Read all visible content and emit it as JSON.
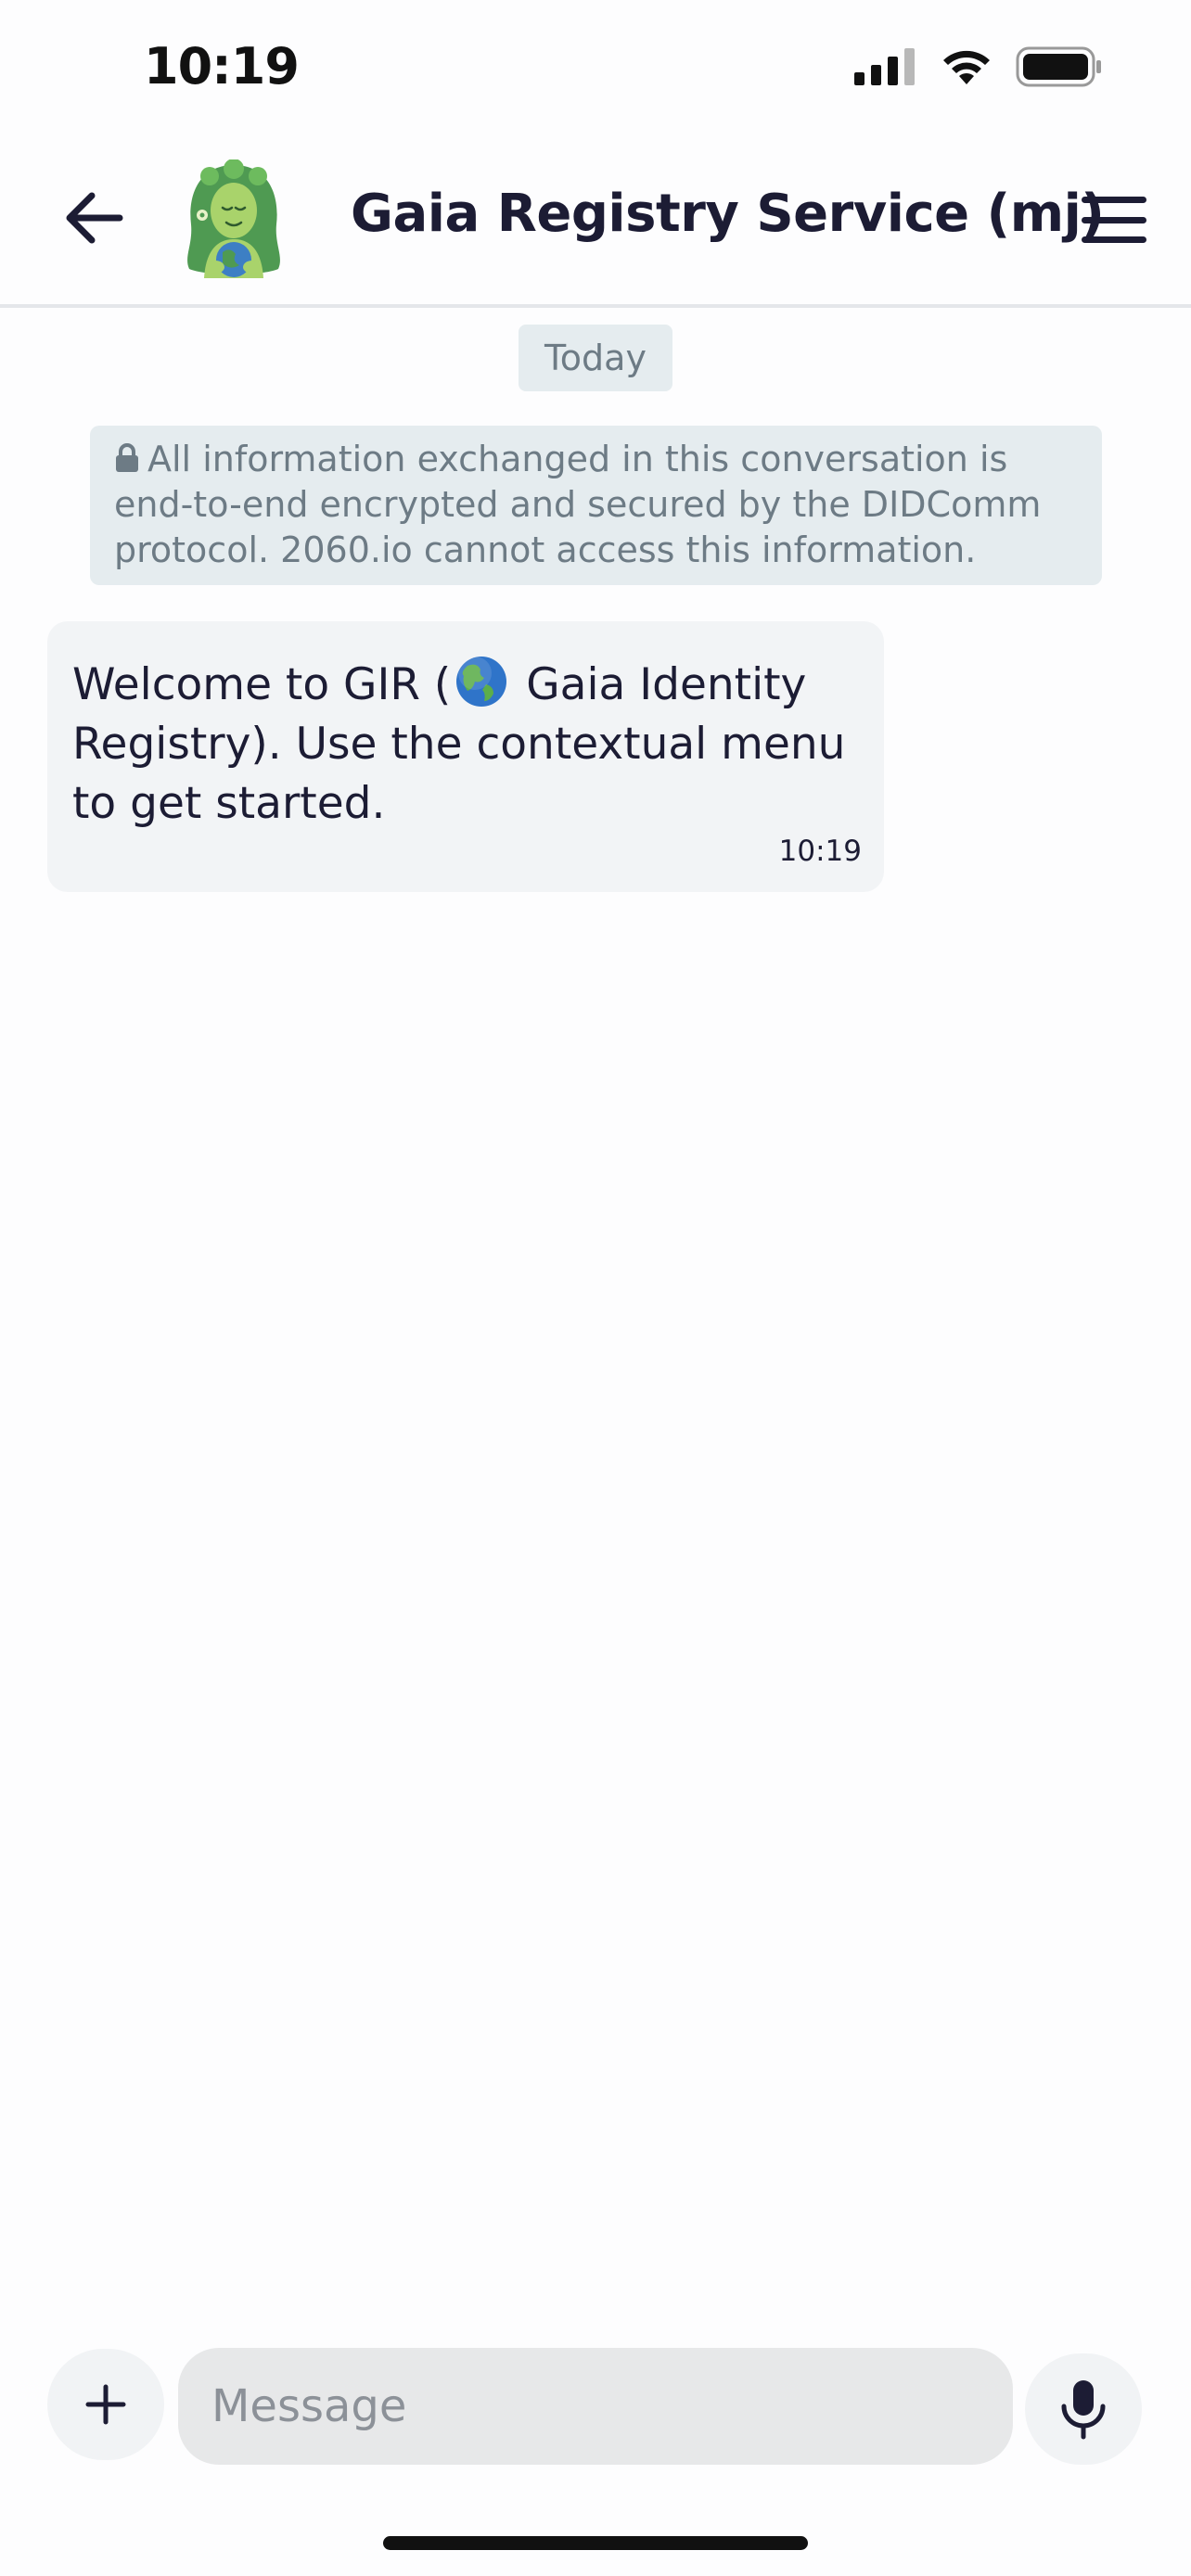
{
  "status_bar": {
    "time": "10:19",
    "icons": [
      "cellular-signal-icon",
      "wifi-icon",
      "battery-icon"
    ]
  },
  "header": {
    "back_icon": "arrow-left-icon",
    "avatar": "gaia-avatar",
    "title": "Gaia Registry Service (mj)",
    "menu_icon": "hamburger-menu-icon"
  },
  "conversation": {
    "date_label": "Today",
    "encryption_notice": "All information exchanged in this conversation is end-to-end encrypted and secured by the DIDComm protocol. 2060.io cannot access this information.",
    "messages": [
      {
        "text_before_emoji": "Welcome to GIR (",
        "emoji": "globe-americas-icon",
        "text_after_emoji": " Gaia Identity Registry). Use the contextual menu to get started.",
        "time": "10:19"
      }
    ]
  },
  "composer": {
    "add_icon": "plus-icon",
    "placeholder": "Message",
    "value": "",
    "mic_icon": "microphone-icon"
  },
  "colors": {
    "title_text": "#1c1c34",
    "notice_bg": "#e5ecef",
    "notice_text": "#6d7b85",
    "bubble_bg": "#f2f4f6",
    "input_bg": "#e7e8e9"
  }
}
